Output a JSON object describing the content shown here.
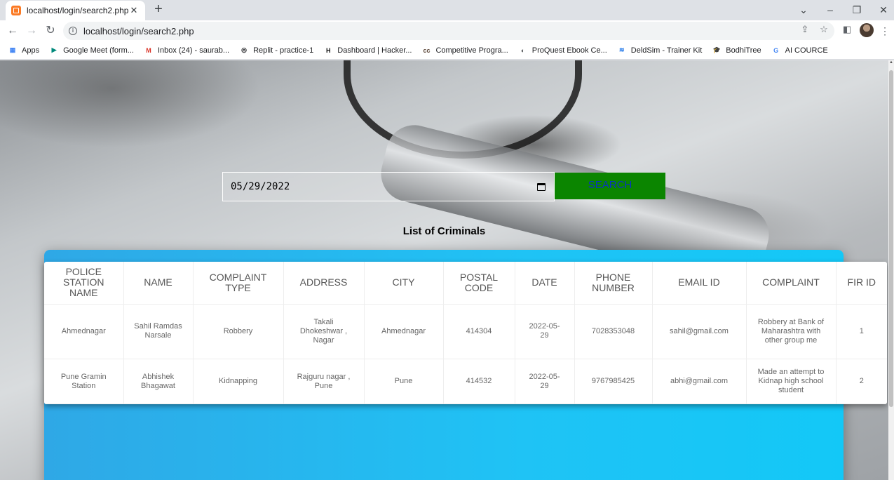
{
  "browser": {
    "tab_title": "localhost/login/search2.php",
    "new_tab": "+",
    "url": "localhost/login/search2.php",
    "bookmarks": [
      {
        "label": "Apps",
        "icon": "apps-grid-icon",
        "color": "#4285f4"
      },
      {
        "label": "Google Meet (form...",
        "icon": "google-meet-icon",
        "color": "#00897b"
      },
      {
        "label": "Inbox (24) - saurab...",
        "icon": "gmail-icon",
        "color": "#d93025"
      },
      {
        "label": "Replit - practice-1",
        "icon": "replit-icon",
        "color": "#202124"
      },
      {
        "label": "Dashboard | Hacker...",
        "icon": "hackerrank-icon",
        "color": "#0a0a0a"
      },
      {
        "label": "Competitive Progra...",
        "icon": "cc-icon",
        "color": "#5b4638"
      },
      {
        "label": "ProQuest Ebook Ce...",
        "icon": "proquest-icon",
        "color": "#3c4043"
      },
      {
        "label": "DeldSim - Trainer Kit",
        "icon": "deldsim-icon",
        "color": "#1a73e8"
      },
      {
        "label": "BodhiTree",
        "icon": "graduation-cap-icon",
        "color": "#202124"
      },
      {
        "label": "AI COURCE",
        "icon": "google-icon",
        "color": "#4285f4"
      }
    ]
  },
  "search": {
    "date_value": "05/29/2022",
    "button_label": "SEARCH"
  },
  "list_title": "List of Criminals",
  "table": {
    "headers": [
      "POLICE STATION NAME",
      "NAME",
      "COMPLAINT TYPE",
      "ADDRESS",
      "CITY",
      "POSTAL CODE",
      "DATE",
      "PHONE NUMBER",
      "EMAIL ID",
      "COMPLAINT",
      "FIR ID"
    ],
    "rows": [
      [
        "Ahmednagar",
        "Sahil Ramdas Narsale",
        "Robbery",
        "Takali Dhokeshwar , Nagar",
        "Ahmednagar",
        "414304",
        "2022-05-29",
        "7028353048",
        "sahil@gmail.com",
        "Robbery at Bank of Maharashtra with other group me",
        "1"
      ],
      [
        "Pune Gramin Station",
        "Abhishek Bhagawat",
        "Kidnapping",
        "Rajguru nagar , Pune",
        "Pune",
        "414532",
        "2022-05-29",
        "9767985425",
        "abhi@gmail.com",
        "Made an attempt to Kidnap high school student",
        "2"
      ]
    ]
  },
  "colors": {
    "search_button": "#0b8500",
    "search_text": "#0a33c2",
    "card_blue": "#1fc3f5"
  }
}
